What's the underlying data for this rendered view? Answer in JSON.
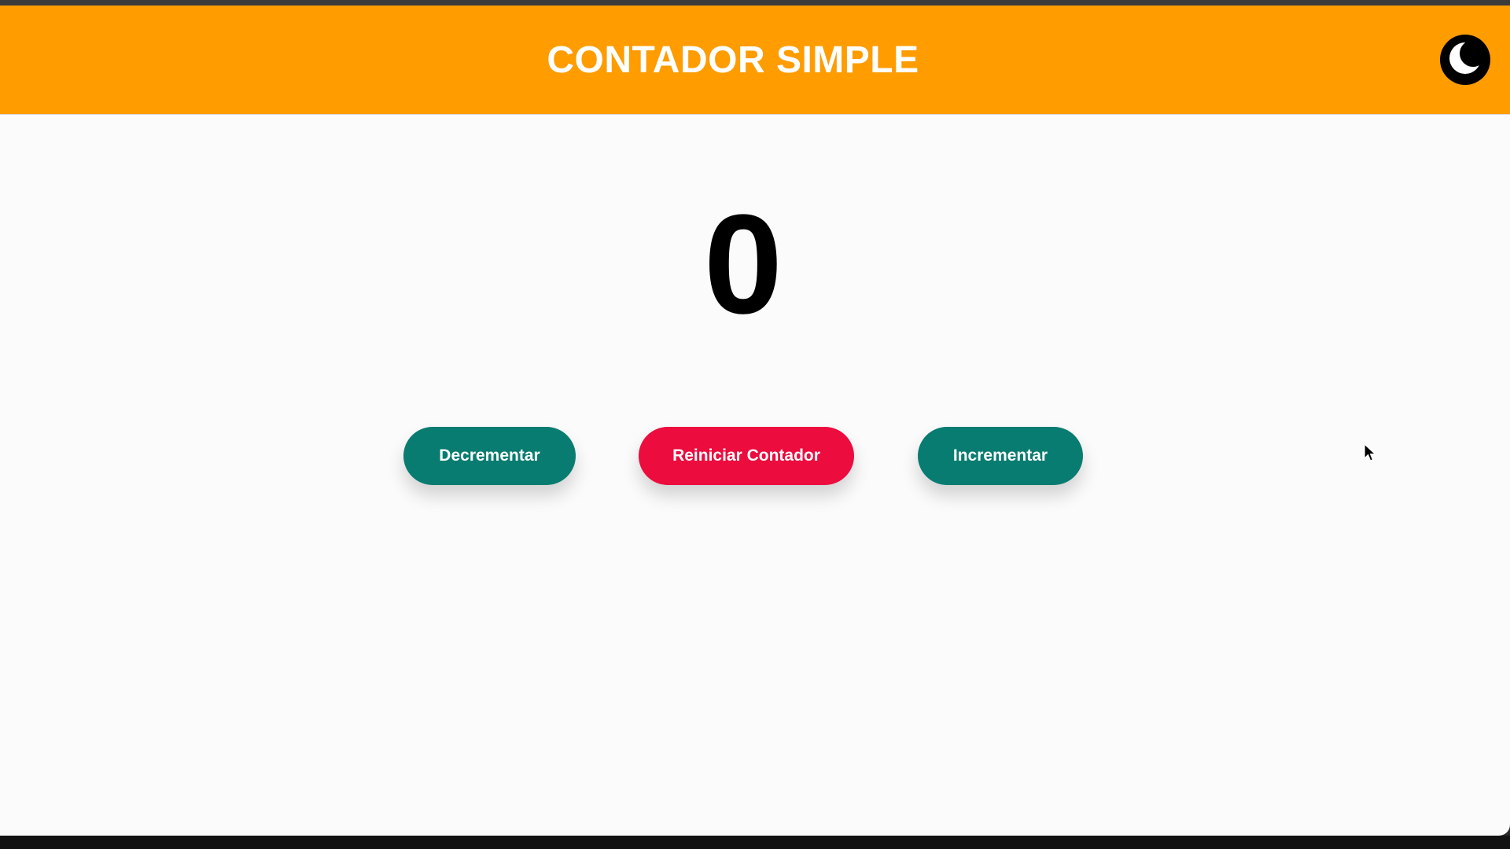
{
  "header": {
    "title": "CONTADOR SIMPLE",
    "theme_toggle_icon": "moon-icon",
    "background_color": "#fe9c00"
  },
  "counter": {
    "value": "0"
  },
  "buttons": {
    "decrement_label": "Decrementar",
    "reset_label": "Reiniciar Contador",
    "increment_label": "Incrementar"
  },
  "colors": {
    "primary_button": "#087c70",
    "reset_button": "#ec0c3e"
  }
}
